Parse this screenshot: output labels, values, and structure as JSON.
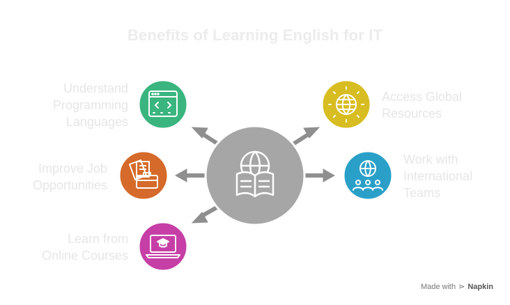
{
  "title": "Benefits of Learning English for IT",
  "center": {
    "icon": "book-globe-icon",
    "color": "#a6a6a6"
  },
  "benefits": [
    {
      "label": "Understand Programming Languages",
      "icon": "code-window-icon",
      "color": "#3ab57f"
    },
    {
      "label": "Improve Job Opportunities",
      "icon": "briefcase-documents-icon",
      "color": "#d56a2a"
    },
    {
      "label": "Learn from Online Courses",
      "icon": "laptop-graduation-icon",
      "color": "#c63fa6"
    },
    {
      "label": "Access Global Resources",
      "icon": "globe-icon",
      "color": "#d8bd22"
    },
    {
      "label": "Work with International Teams",
      "icon": "globe-team-icon",
      "color": "#2aa0c8"
    }
  ],
  "footer": {
    "made_with": "Made with",
    "brand": "Napkin"
  }
}
